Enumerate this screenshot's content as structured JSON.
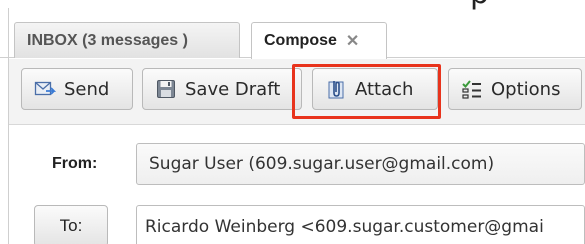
{
  "header": {
    "cut_text": "p"
  },
  "tabs": [
    {
      "label": "INBOX (3 messages )"
    },
    {
      "label": "Compose",
      "close": "✕"
    }
  ],
  "toolbar": {
    "send_label": "Send",
    "save_draft_label": "Save Draft",
    "attach_label": "Attach",
    "options_label": "Options",
    "highlighted": "Attach",
    "highlight_color": "#e8331c"
  },
  "form": {
    "from_label": "From:",
    "from_value": "Sugar User (609.sugar.user@gmail.com)",
    "to_button_label": "To:",
    "to_value": "Ricardo Weinberg <609.sugar.customer@gmai"
  },
  "icons": [
    "send-icon",
    "save-icon",
    "paperclip-icon",
    "options-icon"
  ]
}
